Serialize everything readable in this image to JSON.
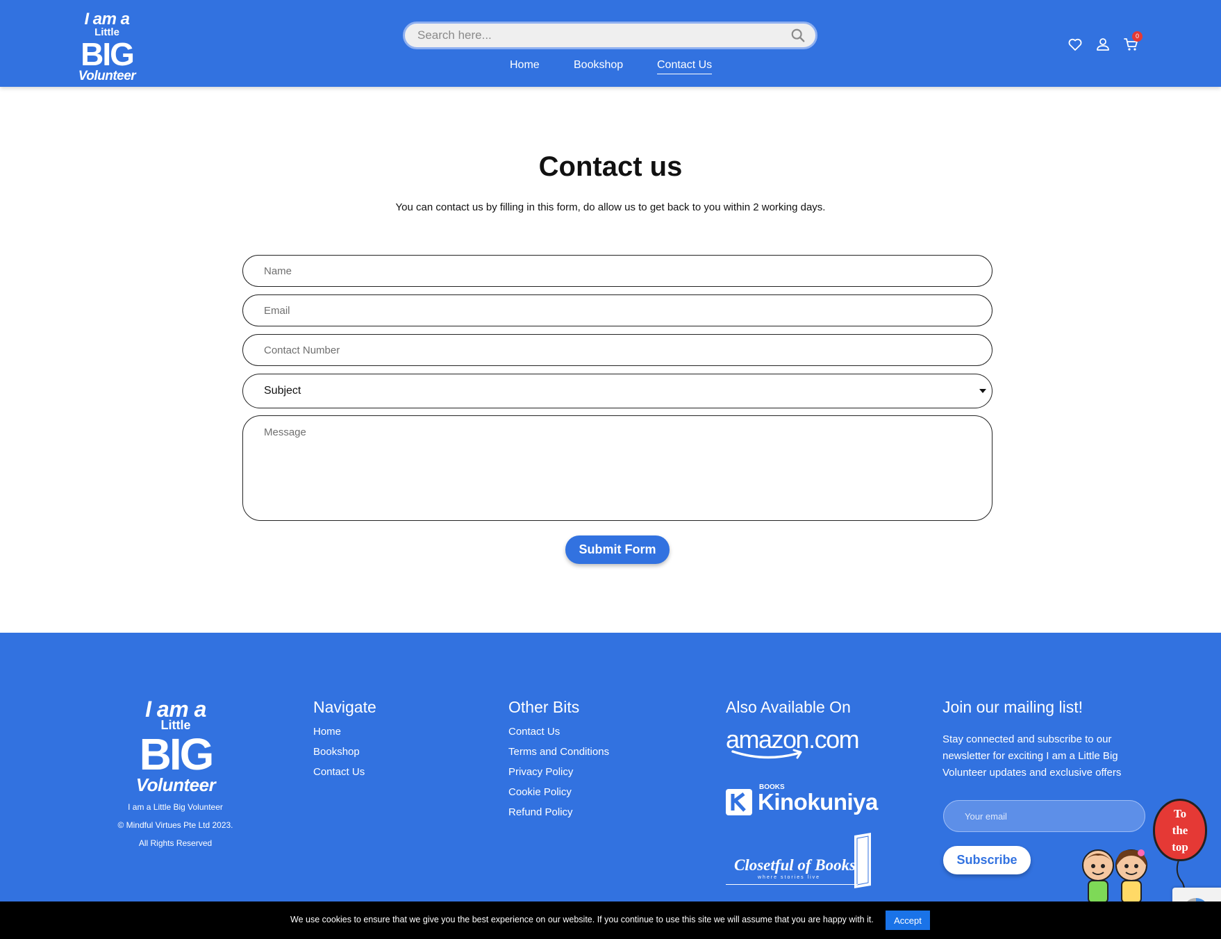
{
  "colors": {
    "brand": "#3272E0",
    "accent_badge": "#e53935",
    "cookie_bar": "#000000",
    "accept": "#1a73e8"
  },
  "header": {
    "logo": {
      "line1": "I am a",
      "line2": "Little",
      "line3": "BIG",
      "line4": "Volunteer"
    },
    "search_placeholder": "Search here...",
    "nav": [
      {
        "label": "Home"
      },
      {
        "label": "Bookshop"
      },
      {
        "label": "Contact Us",
        "active": true
      }
    ],
    "icons": [
      "heart-icon",
      "user-icon",
      "cart-icon"
    ],
    "cart_count": "0"
  },
  "main": {
    "title": "Contact us",
    "subtitle": "You can contact us by filling in this form, do allow us to get back to you within 2 working days.",
    "form": {
      "name_placeholder": "Name",
      "email_placeholder": "Email",
      "contact_placeholder": "Contact Number",
      "subject_value": "Subject",
      "message_placeholder": "Message",
      "submit_label": "Submit Form"
    }
  },
  "footer": {
    "logo": {
      "line1": "I am a",
      "line2": "Little",
      "line3": "BIG",
      "line4": "Volunteer"
    },
    "company_lines": [
      "I am a Little Big Volunteer",
      "© Mindful Virtues Pte Ltd 2023.",
      "All Rights Reserved"
    ],
    "navigate": {
      "heading": "Navigate",
      "links": [
        "Home",
        "Bookshop",
        "Contact Us"
      ]
    },
    "other_bits": {
      "heading": "Other Bits",
      "links": [
        "Contact Us",
        "Terms and Conditions",
        "Privacy Policy",
        "Cookie Policy",
        "Refund Policy"
      ]
    },
    "also_available": {
      "heading": "Also Available On",
      "amazon": "amazon.com",
      "kino_small": "BOOKS",
      "kino": "Kinokuniya",
      "closet": "Closetful of Books",
      "closet_tag": "where stories live"
    },
    "mailing": {
      "heading": "Join our mailing list!",
      "description": "Stay connected and subscribe to our newsletter for exciting I am a Little Big Volunteer updates and exclusive offers",
      "email_placeholder": "Your email",
      "subscribe_label": "Subscribe"
    },
    "to_top": {
      "line1": "To",
      "line2": "the",
      "line3": "top"
    }
  },
  "cookie_bar": {
    "text": "We use cookies to ensure that we give you the best experience on our website. If you continue to use this site we will assume that you are happy with it.",
    "accept_label": "Accept"
  }
}
